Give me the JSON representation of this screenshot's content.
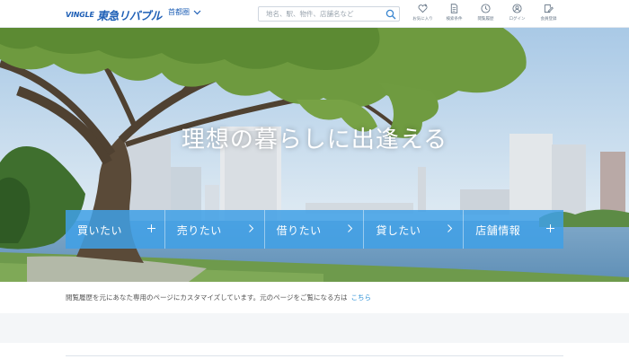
{
  "header": {
    "logo_mark": "VINGLE",
    "logo_text": "東急リバブル",
    "region": "首都圏",
    "search_placeholder": "地名、駅、物件、店舗名など",
    "nav": [
      {
        "label": "お気に入り",
        "icon": "heart-plus-icon"
      },
      {
        "label": "検索条件",
        "icon": "document-icon"
      },
      {
        "label": "閲覧履歴",
        "icon": "clock-icon"
      },
      {
        "label": "ログイン",
        "icon": "user-icon"
      },
      {
        "label": "会員登録",
        "icon": "edit-icon"
      }
    ]
  },
  "hero": {
    "title": "理想の暮らしに出逢える",
    "menu": [
      {
        "label": "買いたい",
        "arrow": "plus"
      },
      {
        "label": "売りたい",
        "arrow": "chevron"
      },
      {
        "label": "借りたい",
        "arrow": "chevron"
      },
      {
        "label": "貸したい",
        "arrow": "chevron"
      },
      {
        "label": "店舗情報",
        "arrow": "plus"
      }
    ]
  },
  "notice": {
    "text": "閲覧履歴を元にあなた専用のページにカスタマイズしています。元のページをご覧になる方は",
    "link": "こちら"
  },
  "colors": {
    "brand": "#1e5fb6",
    "menu_blue": "#40a0e6",
    "link": "#2a8fd6"
  }
}
